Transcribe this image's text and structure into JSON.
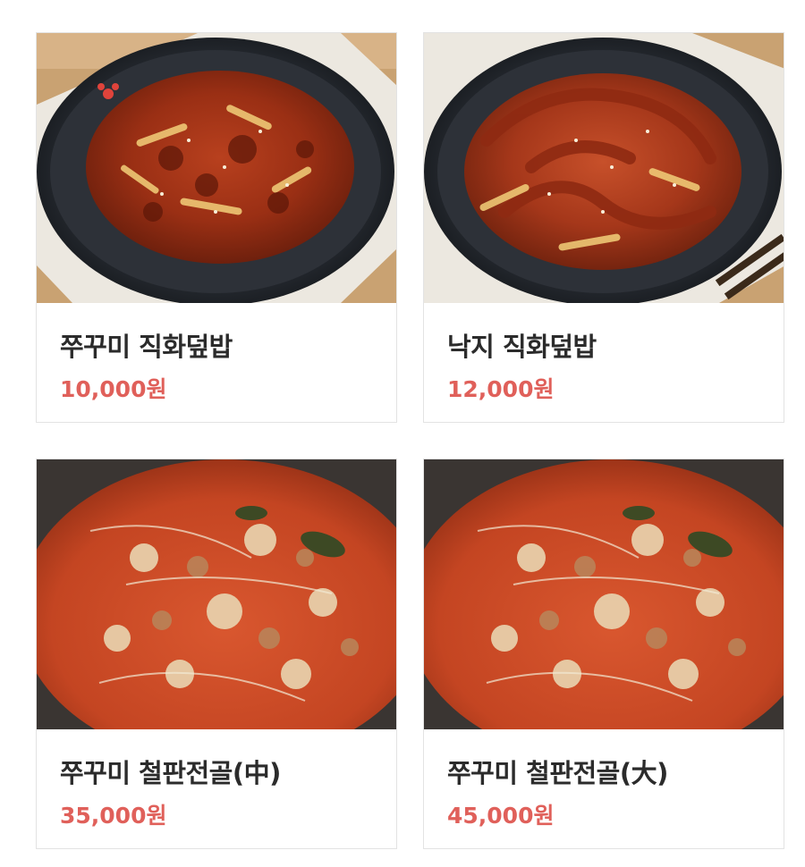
{
  "menu": {
    "items": [
      {
        "name": "쭈꾸미 직화덮밥",
        "price": "10,000원",
        "image": "stir-fried-webfoot-octopus-photo"
      },
      {
        "name": "낙지 직화덮밥",
        "price": "12,000원",
        "image": "stir-fried-small-octopus-photo"
      },
      {
        "name": "쭈꾸미 철판전골(中)",
        "price": "35,000원",
        "image": "webfoot-octopus-hotpot-photo"
      },
      {
        "name": "쭈꾸미 철판전골(大)",
        "price": "45,000원",
        "image": "webfoot-octopus-hotpot-photo"
      }
    ]
  },
  "colors": {
    "price": "#e0605a",
    "title": "#2b2b2b",
    "card_border": "#e3e3e3"
  }
}
